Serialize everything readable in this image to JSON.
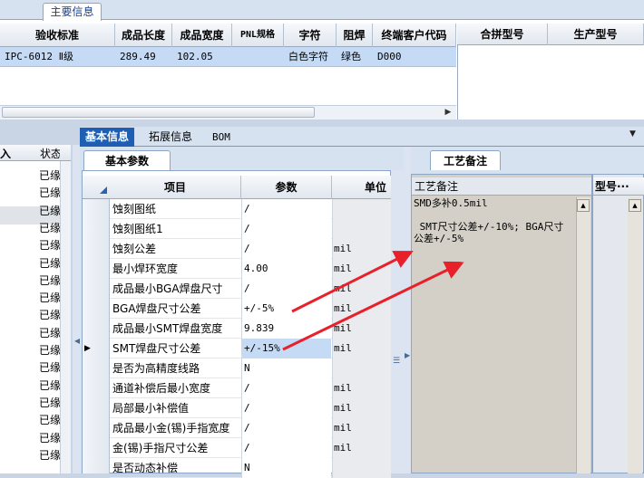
{
  "top": {
    "tab_label": "主要信息",
    "columns": [
      "验收标准",
      "成品长度",
      "成品宽度",
      "PNL规格",
      "字符",
      "阻焊",
      "终端客户代码"
    ],
    "row": {
      "acceptance": "IPC-6012 Ⅱ级",
      "length": "289.49",
      "width": "102.05",
      "pnl": "",
      "char": "白色字符",
      "mask": "绿色",
      "customer_code": "D000"
    },
    "right_columns": [
      "合拼型号",
      "生产型号"
    ],
    "scroll_right_icon": "▶"
  },
  "left_strip": {
    "header_partial": "入",
    "status_header": "状态",
    "status_values": [
      "已缘",
      "已缘",
      "已缘",
      "已缘",
      "已缘",
      "已缘",
      "已缘",
      "已缘",
      "已缘",
      "已缘",
      "已缘",
      "已缘",
      "已缘",
      "已缘",
      "已缘",
      "已缘",
      "已缘"
    ]
  },
  "bottom_tabs": {
    "basic": "基本信息",
    "ext": "拓展信息",
    "bom": "BOM",
    "menu_icon": "▼"
  },
  "basic": {
    "subtab": "基本参数",
    "headers": {
      "item": "项目",
      "param": "参数",
      "unit": "单位"
    },
    "rows": [
      {
        "item": "蚀刻图纸",
        "param": "/",
        "unit": ""
      },
      {
        "item": "蚀刻图纸1",
        "param": "/",
        "unit": ""
      },
      {
        "item": "蚀刻公差",
        "param": "/",
        "unit": "mil"
      },
      {
        "item": "最小焊环宽度",
        "param": "4.00",
        "unit": "mil"
      },
      {
        "item": "成品最小BGA焊盘尺寸",
        "param": "/",
        "unit": "mil"
      },
      {
        "item": "BGA焊盘尺寸公差",
        "param": "+/-5%",
        "unit": "mil"
      },
      {
        "item": "成品最小SMT焊盘宽度",
        "param": "9.839",
        "unit": "mil"
      },
      {
        "item": "SMT焊盘尺寸公差",
        "param": "+/-15%",
        "unit": "mil"
      },
      {
        "item": "是否为高精度线路",
        "param": "N",
        "unit": ""
      },
      {
        "item": "通道补偿后最小宽度",
        "param": "/",
        "unit": "mil"
      },
      {
        "item": "局部最小补偿值",
        "param": "/",
        "unit": "mil"
      },
      {
        "item": "成品最小金(锡)手指宽度",
        "param": "/",
        "unit": "mil"
      },
      {
        "item": "金(锡)手指尺寸公差",
        "param": "/",
        "unit": "mil"
      },
      {
        "item": "是否动态补偿",
        "param": "N",
        "unit": ""
      }
    ],
    "current_row_icon": "▶"
  },
  "notes": {
    "subtab": "工艺备注",
    "header": "工艺备注",
    "text": "SMD多补0.5mil\n\n SMT尺寸公差+/-10%; BGA尺寸公差+/-5%",
    "model_header": "型号···"
  },
  "colors": {
    "accent": "#1e5fb4",
    "selected_row": "#c5dbf5",
    "arrow": "#e8202a"
  }
}
